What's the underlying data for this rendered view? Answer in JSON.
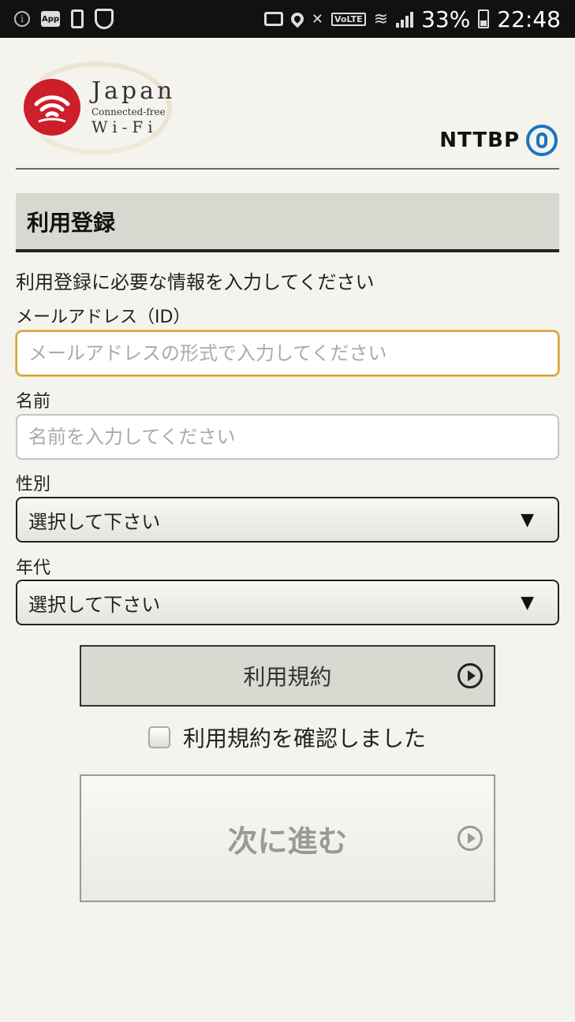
{
  "status_bar": {
    "battery": "33%",
    "time": "22:48",
    "volte": "VoLTE",
    "app_badge": "App"
  },
  "header": {
    "logo_title": "Japan",
    "logo_subtitle": "Connected-free",
    "logo_wifi": "Wi-Fi",
    "brand": "NTTBP"
  },
  "section": {
    "title": "利用登録",
    "intro": "利用登録に必要な情報を入力してください"
  },
  "form": {
    "email_label": "メールアドレス（ID）",
    "email_placeholder": "メールアドレスの形式で入力してください",
    "email_value": "",
    "name_label": "名前",
    "name_placeholder": "名前を入力してください",
    "name_value": "",
    "gender_label": "性別",
    "gender_selected": "選択して下さい",
    "age_label": "年代",
    "age_selected": "選択して下さい",
    "select_arrow": "▼"
  },
  "terms": {
    "button_label": "利用規約",
    "agree_label": "利用規約を確認しました",
    "agree_checked": false
  },
  "next": {
    "button_label": "次に進む"
  },
  "colors": {
    "logo_red": "#cc1f2b",
    "nttbp_blue": "#1b74c0",
    "focus_border": "#d6a43a",
    "background": "#f4f3ed"
  }
}
